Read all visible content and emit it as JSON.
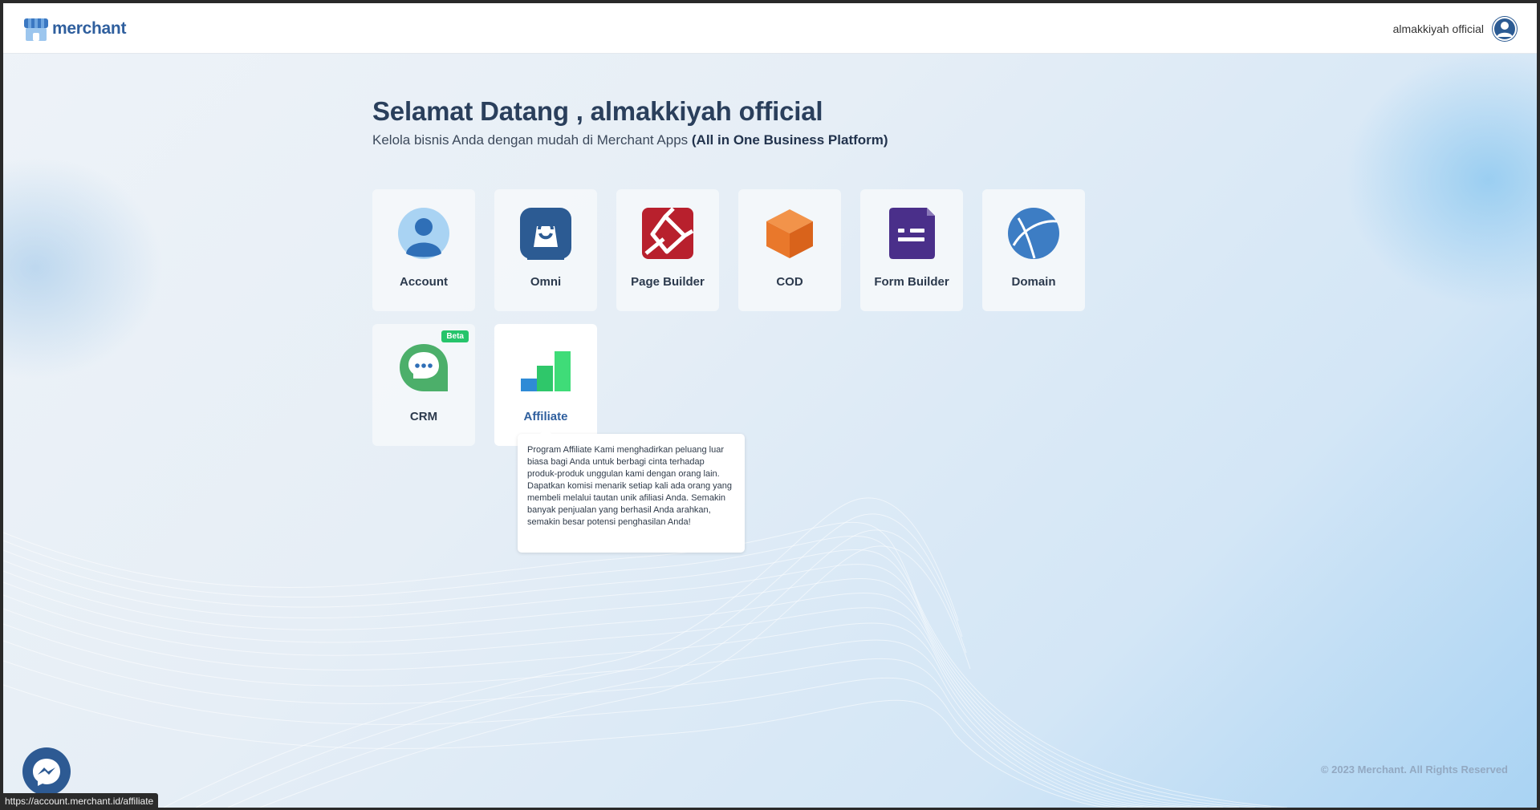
{
  "brand": {
    "name": "merchant",
    "color": "#2f5f9e"
  },
  "header": {
    "user_name": "almakkiyah official"
  },
  "welcome": {
    "title": "Selamat Datang , almakkiyah official",
    "subtitle_prefix": "Kelola bisnis Anda dengan mudah di Merchant Apps ",
    "subtitle_bold": "(All in One Business Platform)"
  },
  "apps": [
    {
      "label": "Account",
      "icon": "account-icon"
    },
    {
      "label": "Omni",
      "icon": "shopping-bag-icon"
    },
    {
      "label": "Page Builder",
      "icon": "page-builder-icon"
    },
    {
      "label": "COD",
      "icon": "box-icon"
    },
    {
      "label": "Form Builder",
      "icon": "form-icon"
    },
    {
      "label": "Domain",
      "icon": "globe-icon"
    },
    {
      "label": "CRM",
      "icon": "chat-icon",
      "badge": "Beta"
    },
    {
      "label": "Affiliate",
      "icon": "bar-chart-icon"
    }
  ],
  "tooltip": {
    "text": "Program Affiliate Kami menghadirkan peluang luar biasa bagi Anda untuk berbagi cinta terhadap produk-produk unggulan kami dengan orang lain. Dapatkan komisi menarik setiap kali ada orang yang membeli melalui tautan unik afiliasi Anda. Semakin banyak penjualan yang berhasil Anda arahkan, semakin besar potensi penghasilan Anda!"
  },
  "footer": {
    "copyright": "© 2023 Merchant. All Rights Reserved"
  },
  "status_bar": {
    "url": "https://account.merchant.id/affiliate"
  },
  "colors": {
    "badge": "#26c46b",
    "account": "#2f6fb7",
    "omni": "#2c5b93",
    "page_builder": "#b8202d",
    "cod": "#e9782b",
    "form_builder": "#4a2f8a",
    "domain": "#3d7dc4",
    "crm": "#4caf6a",
    "affiliate": "#2fc76a"
  }
}
